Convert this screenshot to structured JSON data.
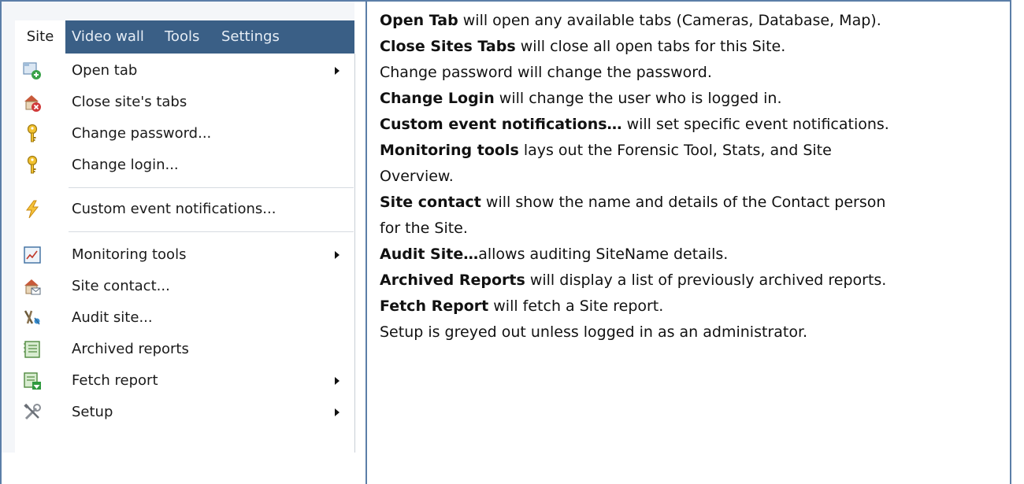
{
  "menubar": {
    "items": [
      "Site",
      "Video wall",
      "Tools",
      "Settings"
    ]
  },
  "site_menu": {
    "items": [
      {
        "label": "Open tab",
        "icon": "open-tab-icon",
        "submenu": true
      },
      {
        "label": "Close site's tabs",
        "icon": "close-site-tabs-icon",
        "submenu": false
      },
      {
        "label": "Change password...",
        "icon": "key-icon",
        "submenu": false
      },
      {
        "label": "Change login...",
        "icon": "key-icon",
        "submenu": false
      },
      {
        "label": "Custom event notifications...",
        "icon": "lightning-icon",
        "submenu": false
      },
      {
        "label": "Monitoring tools",
        "icon": "chart-icon",
        "submenu": true
      },
      {
        "label": "Site contact...",
        "icon": "site-contact-icon",
        "submenu": false
      },
      {
        "label": "Audit site...",
        "icon": "audit-icon",
        "submenu": false
      },
      {
        "label": "Archived reports",
        "icon": "archive-icon",
        "submenu": false
      },
      {
        "label": "Fetch report",
        "icon": "fetch-report-icon",
        "submenu": true
      },
      {
        "label": "Setup",
        "icon": "tools-icon",
        "submenu": true
      }
    ]
  },
  "descriptions": [
    {
      "bold": "Open Tab",
      "text": " will open any available tabs (Cameras, Database, Map)."
    },
    {
      "bold": "Close Sites Tabs",
      "text": " will close all open tabs for this Site."
    },
    {
      "bold": "",
      "text": "Change password will change the password."
    },
    {
      "bold": "Change Login",
      "text": " will change the user who is logged in."
    },
    {
      "bold": "Custom event notifications…",
      "text": " will set specific event notifications."
    },
    {
      "bold": "Monitoring tools",
      "text": " lays out the Forensic Tool, Stats, and Site"
    },
    {
      "bold": "",
      "text": "Overview."
    },
    {
      "bold": "Site contact",
      "text": " will show the name and details of the Contact person"
    },
    {
      "bold": "",
      "text": "for the Site."
    },
    {
      "bold": "Audit Site…",
      "text": "allows auditing SiteName details."
    },
    {
      "bold": "Archived Reports",
      "text": " will display a list of previously archived reports."
    },
    {
      "bold": "Fetch Report",
      "text": " will fetch a Site report."
    },
    {
      "bold": "",
      "text": "Setup is greyed out unless logged in as an administrator."
    }
  ],
  "colors": {
    "menubar_bg": "#3a5f86",
    "table_border": "#5b7ea8",
    "menu_bg": "#ffffff"
  }
}
